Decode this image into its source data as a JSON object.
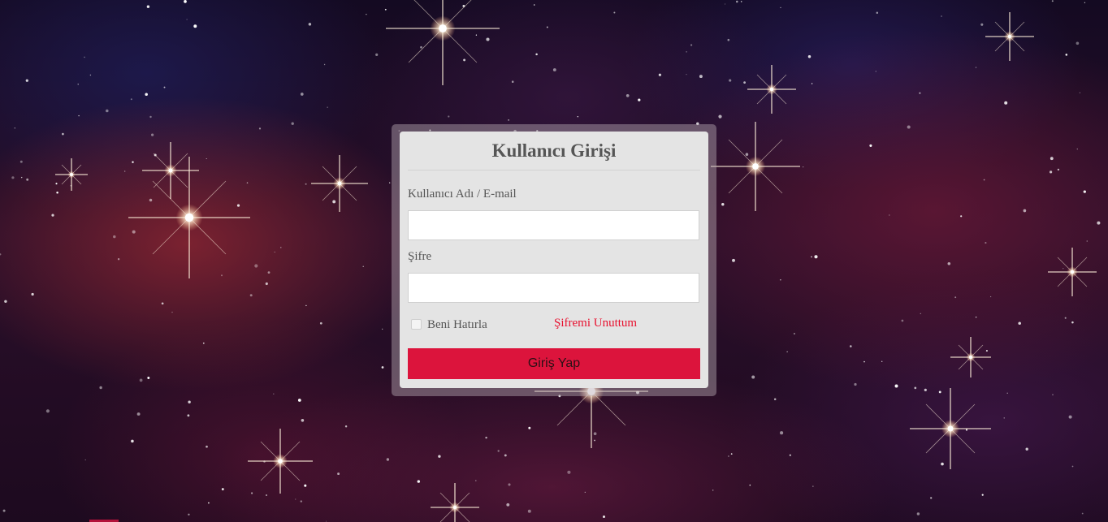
{
  "login": {
    "title": "Kullanıcı Girişi",
    "username_label": "Kullanıcı Adı / E-mail",
    "username_value": "",
    "password_label": "Şifre",
    "password_value": "",
    "remember_label": "Beni Hatırla",
    "remember_checked": false,
    "forgot_link": "Şifremi Unuttum",
    "submit_label": "Giriş Yap"
  },
  "colors": {
    "card_background": "#e4e4e4",
    "accent": "#dc143c",
    "link": "#e8102e",
    "label_text": "#555555"
  },
  "background": {
    "theme": "starry-nebula"
  }
}
